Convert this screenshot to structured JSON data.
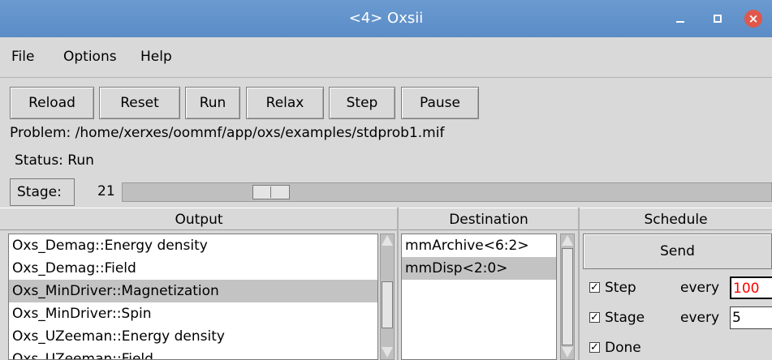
{
  "window": {
    "title": "<4> Oxsii"
  },
  "menu": {
    "file": "File",
    "options": "Options",
    "help": "Help"
  },
  "toolbar": {
    "reload": "Reload",
    "reset": "Reset",
    "run": "Run",
    "relax": "Relax",
    "step": "Step",
    "pause": "Pause"
  },
  "problem": "Problem: /home/xerxes/oommf/app/oxs/examples/stdprob1.mif",
  "status": "Status: Run",
  "stage": {
    "label": "Stage:",
    "value": "21"
  },
  "columns": {
    "output": "Output",
    "destination": "Destination",
    "schedule": "Schedule"
  },
  "outputs": [
    "Oxs_Demag::Energy density",
    "Oxs_Demag::Field",
    "Oxs_MinDriver::Magnetization",
    "Oxs_MinDriver::Spin",
    "Oxs_UZeeman::Energy density",
    "Oxs_UZeeman::Field"
  ],
  "destinations": [
    "mmArchive<6:2>",
    "mmDisp<2:0>"
  ],
  "schedule": {
    "send": "Send",
    "step_label": "Step",
    "stage_label": "Stage",
    "done_label": "Done",
    "every": "every",
    "step_every": "100",
    "stage_every": "5"
  },
  "colors": {
    "titlebar": "#5b8cc6",
    "selection": "#c3c3c3",
    "highlight_text": "#ff0000"
  }
}
